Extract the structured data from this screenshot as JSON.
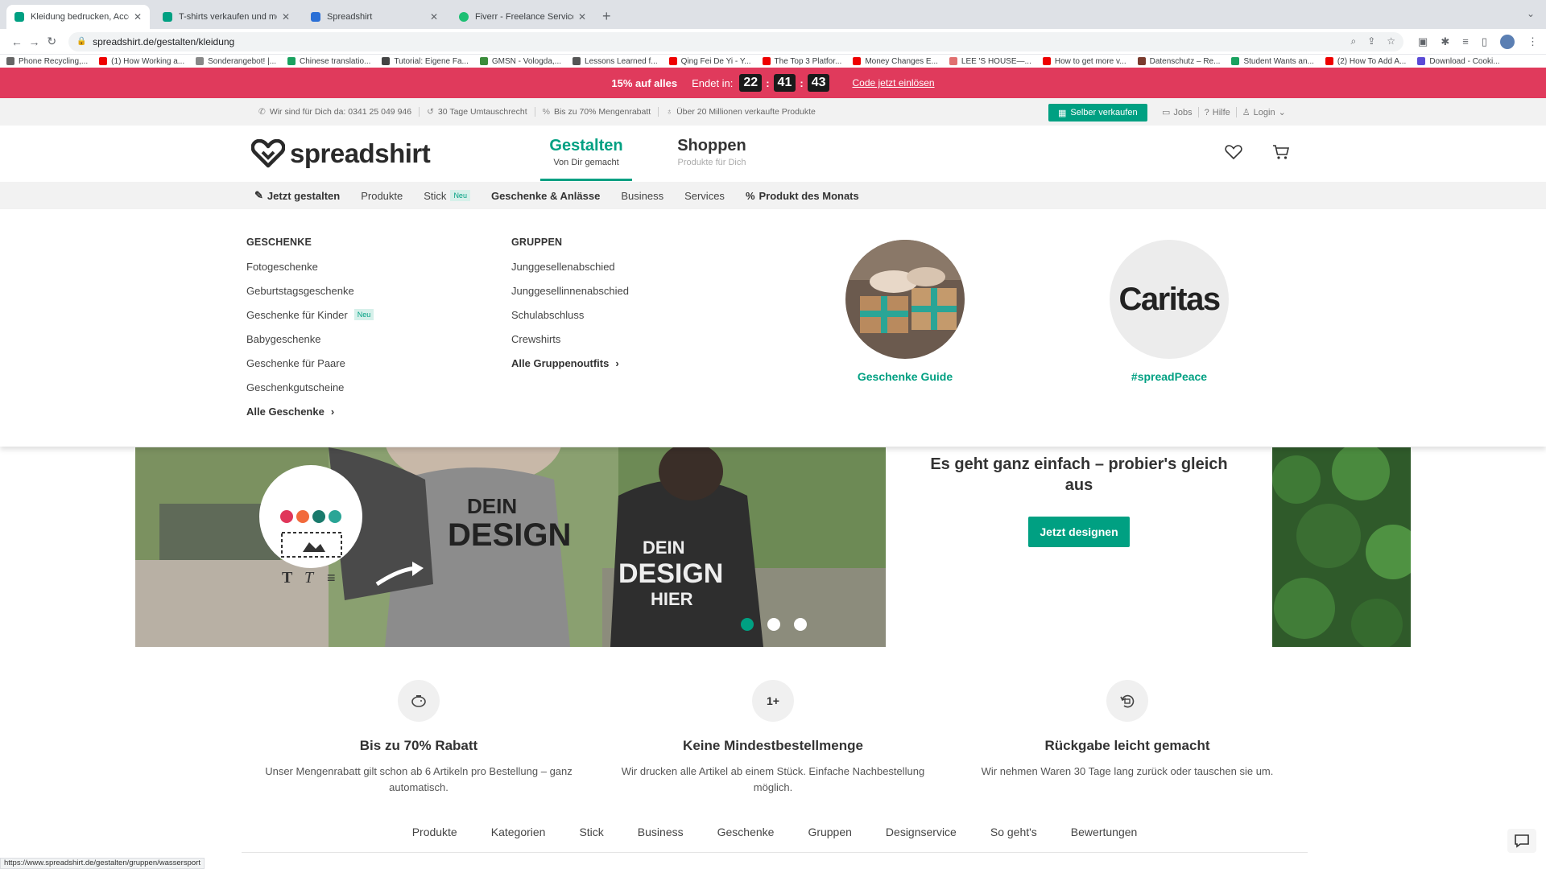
{
  "browser": {
    "tabs": [
      {
        "title": "Kleidung bedrucken, Accessoires",
        "color": "#00a082",
        "active": true
      },
      {
        "title": "T-shirts verkaufen und merch",
        "color": "#00a082",
        "active": false
      },
      {
        "title": "Spreadshirt",
        "color": "#2a6fd6",
        "active": false
      },
      {
        "title": "Fiverr - Freelance Services Ma",
        "color": "#1dbf73",
        "active": false
      }
    ],
    "url": "spreadshirt.de/gestalten/kleidung",
    "bookmarks": [
      {
        "label": "Phone Recycling,...",
        "color": "#666"
      },
      {
        "label": "(1) How Working a...",
        "color": "#e00"
      },
      {
        "label": "Sonderangebot! |...",
        "color": "#888"
      },
      {
        "label": "Chinese translatio...",
        "color": "#1aa260"
      },
      {
        "label": "Tutorial: Eigene Fa...",
        "color": "#444"
      },
      {
        "label": "GMSN - Vologda,...",
        "color": "#3b8c3b"
      },
      {
        "label": "Lessons Learned f...",
        "color": "#555"
      },
      {
        "label": "Qing Fei De Yi - Y...",
        "color": "#e00"
      },
      {
        "label": "The Top 3 Platfor...",
        "color": "#e00"
      },
      {
        "label": "Money Changes E...",
        "color": "#e00"
      },
      {
        "label": "LEE 'S HOUSE—...",
        "color": "#e07070"
      },
      {
        "label": "How to get more v...",
        "color": "#e00"
      },
      {
        "label": "Datenschutz – Re...",
        "color": "#7a3b2e"
      },
      {
        "label": "Student Wants an...",
        "color": "#1aa260"
      },
      {
        "label": "(2) How To Add A...",
        "color": "#e00"
      },
      {
        "label": "Download - Cooki...",
        "color": "#5b4bd6"
      }
    ],
    "status_url": "https://www.spreadshirt.de/gestalten/gruppen/wassersport"
  },
  "promo": {
    "discount": "15% auf alles",
    "ends_label": "Endet in:",
    "hours": "22",
    "minutes": "41",
    "seconds": "43",
    "redeem": "Code jetzt einlösen"
  },
  "infobar": {
    "usps": [
      {
        "icon": "phone-icon",
        "text": "Wir sind für Dich da: 0341 25 049 946"
      },
      {
        "icon": "return-icon",
        "text": "30 Tage Umtauschrecht"
      },
      {
        "icon": "percent-icon",
        "text": "Bis zu 70% Mengenrabatt"
      },
      {
        "icon": "shirt-icon",
        "text": "Über 20 Millionen verkaufte Produkte"
      }
    ],
    "sell_button": "Selber verkaufen",
    "jobs": "Jobs",
    "help": "Hilfe",
    "login": "Login"
  },
  "header": {
    "logo_text": "spreadshirt",
    "gestalten": {
      "title": "Gestalten",
      "subtitle": "Von Dir gemacht"
    },
    "shoppen": {
      "title": "Shoppen",
      "subtitle": "Produkte für Dich"
    }
  },
  "catnav": {
    "create": "Jetzt gestalten",
    "products": "Produkte",
    "stick": "Stick",
    "new_badge": "Neu",
    "gifts": "Geschenke & Anlässe",
    "business": "Business",
    "services": "Services",
    "product_month": "Produkt des Monats"
  },
  "mega": {
    "gifts_heading": "GESCHENKE",
    "gifts": [
      "Fotogeschenke",
      "Geburtstagsgeschenke",
      "Geschenke für Kinder",
      "Babygeschenke",
      "Geschenke für Paare",
      "Geschenkgutscheine"
    ],
    "gifts_new_badge": "Neu",
    "gifts_all": "Alle Geschenke",
    "groups_heading": "GRUPPEN",
    "groups": [
      "Junggesellenabschied",
      "Junggesellinnenabschied",
      "Schulabschluss",
      "Crewshirts"
    ],
    "groups_all": "Alle Gruppenoutfits",
    "card1_label": "Geschenke Guide",
    "card2_text": "Caritas",
    "card2_label": "#spreadPeace"
  },
  "hero": {
    "shirt_text_1": "DEIN",
    "shirt_text_2": "DESIGN",
    "shirt_text_3": "HIER",
    "headline": "Es geht ganz einfach – probier's gleich aus",
    "button": "Jetzt designen",
    "slides": 3,
    "active_slide": 1
  },
  "features": [
    {
      "icon": "piggy-bank-icon",
      "icon_text": "",
      "title": "Bis zu 70% Rabatt",
      "desc": "Unser Mengenrabatt gilt schon ab 6 Artikeln pro Bestellung – ganz automatisch."
    },
    {
      "icon": "one-plus-icon",
      "icon_text": "1+",
      "title": "Keine Mindestbestellmenge",
      "desc": "Wir drucken alle Artikel ab einem Stück. Einfache Nachbestellung möglich."
    },
    {
      "icon": "return-box-icon",
      "icon_text": "",
      "title": "Rückgabe leicht gemacht",
      "desc": "Wir nehmen Waren 30 Tage lang zurück oder tauschen sie um."
    }
  ],
  "bottomnav": [
    "Produkte",
    "Kategorien",
    "Stick",
    "Business",
    "Geschenke",
    "Gruppen",
    "Designservice",
    "So geht's",
    "Bewertungen"
  ],
  "colors": {
    "accent": "#00a082",
    "promo": "#e03a5c"
  }
}
